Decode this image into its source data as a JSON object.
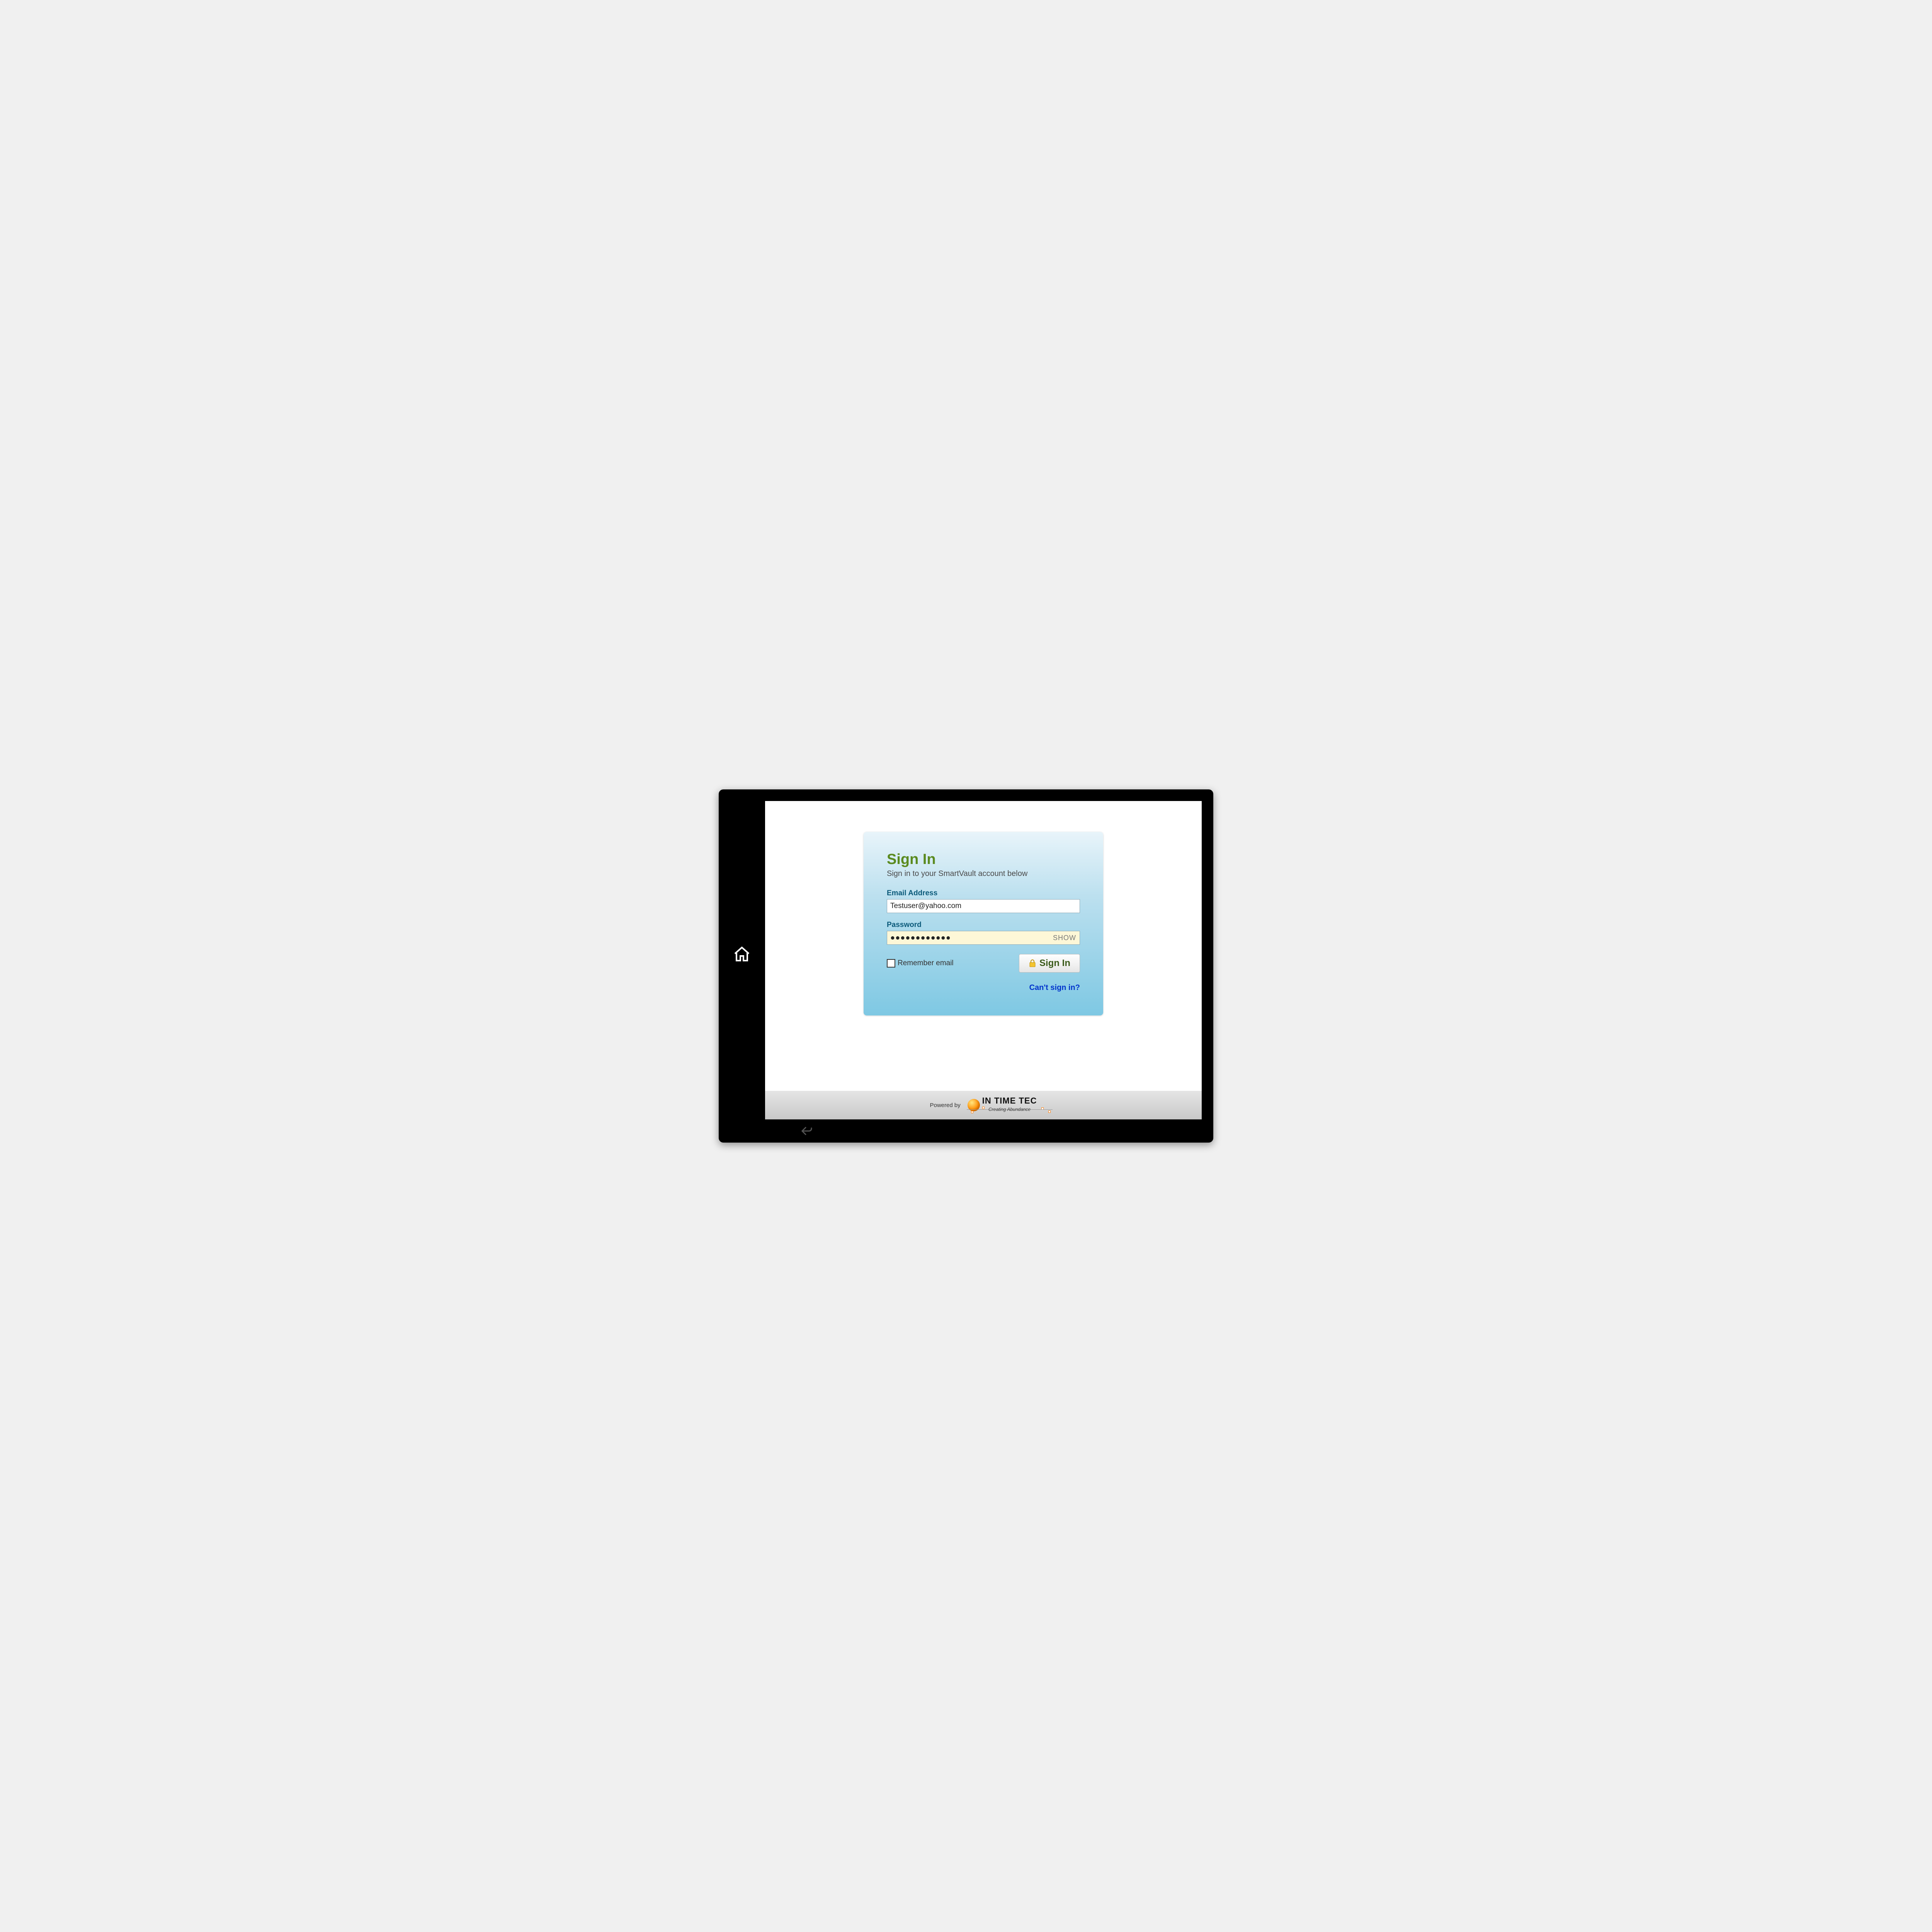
{
  "signin": {
    "title": "Sign In",
    "subtitle": "Sign in to your SmartVault account below",
    "email_label": "Email Address",
    "email_value": "Testuser@yahoo.com",
    "password_label": "Password",
    "password_value": "●●●●●●●●●●●●",
    "show_label": "SHOW",
    "remember_label": "Remember email",
    "remember_checked": false,
    "button_label": "Sign In",
    "cant_signin_label": "Can't sign in?"
  },
  "footer": {
    "powered_by": "Powered by",
    "logo_main": "IN TIME TEC",
    "logo_tagline": "Creating Abundance"
  }
}
